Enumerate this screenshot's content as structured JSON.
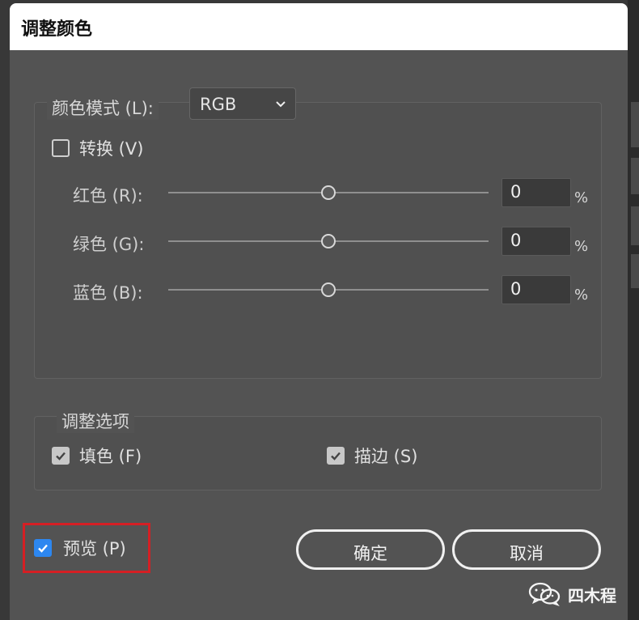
{
  "dialog": {
    "title": "调整颜色"
  },
  "color_mode": {
    "label": "颜色模式 (L):",
    "selected": "RGB"
  },
  "convert": {
    "label": "转换 (V)",
    "checked": false
  },
  "channels": [
    {
      "label": "红色 (R):",
      "value": "0",
      "unit": "%"
    },
    {
      "label": "绿色 (G):",
      "value": "0",
      "unit": "%"
    },
    {
      "label": "蓝色 (B):",
      "value": "0",
      "unit": "%"
    }
  ],
  "adjust_options": {
    "legend": "调整选项",
    "fill": {
      "label": "填色 (F)",
      "checked": true
    },
    "stroke": {
      "label": "描边 (S)",
      "checked": true
    }
  },
  "preview": {
    "label": "预览 (P)",
    "checked": true
  },
  "buttons": {
    "ok": "确定",
    "cancel": "取消"
  },
  "watermark": {
    "text": "四木程",
    "icon": "wechat-icon"
  },
  "colors": {
    "dialog_background": "#535353",
    "accent_blue": "#2d87f0",
    "highlight_red": "#d51f24",
    "title_bar": "#ffffff"
  },
  "icons": {
    "dropdown": "chevron-down-icon",
    "check": "checkmark-icon",
    "slider_handle": "slider-handle-icon"
  }
}
